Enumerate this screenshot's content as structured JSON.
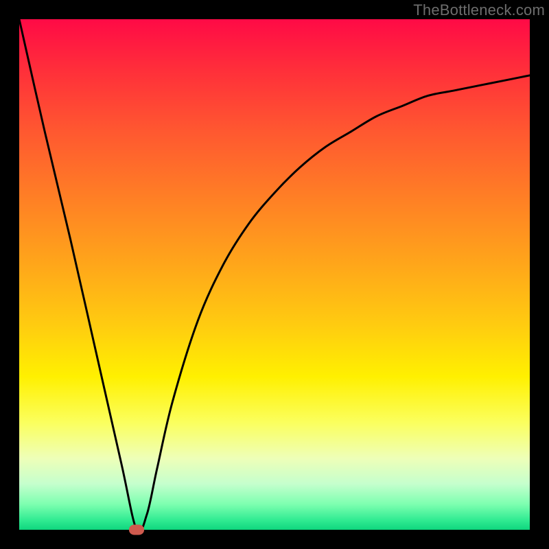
{
  "watermark": "TheBottleneck.com",
  "colors": {
    "frame_background": "#000000",
    "curve_stroke": "#000000",
    "marker_fill": "#cf5a4e",
    "watermark_text": "#6d6d6d",
    "gradient_stops": [
      "#ff0a46",
      "#ff2f3a",
      "#ff5830",
      "#ff7f25",
      "#ffa61a",
      "#ffcc10",
      "#fff000",
      "#fbff5e",
      "#eeffb8",
      "#c5ffcd",
      "#7dffb0",
      "#33ec93",
      "#0fd67e"
    ]
  },
  "chart_data": {
    "type": "line",
    "title": "",
    "xlabel": "",
    "ylabel": "",
    "xlim": [
      0,
      100
    ],
    "ylim": [
      0,
      100
    ],
    "grid": false,
    "legend": false,
    "background": "rainbow-gradient-vertical",
    "note": "y-axis inverted visually: 0 at bottom (green), 100 at top (red). Estimated from pixel positions.",
    "series": [
      {
        "name": "curve",
        "x": [
          0,
          5,
          10,
          15,
          20,
          23,
          25,
          27,
          30,
          35,
          40,
          45,
          50,
          55,
          60,
          65,
          70,
          75,
          80,
          85,
          90,
          95,
          100
        ],
        "y": [
          100,
          78,
          57,
          35,
          13,
          0,
          3,
          12,
          25,
          41,
          52,
          60,
          66,
          71,
          75,
          78,
          81,
          83,
          85,
          86,
          87,
          88,
          89
        ]
      }
    ],
    "annotations": [
      {
        "type": "marker",
        "shape": "rounded-rect",
        "x": 23,
        "y": 0,
        "fill": "#cf5a4e",
        "meaning": "minimum / optimal point"
      }
    ]
  }
}
